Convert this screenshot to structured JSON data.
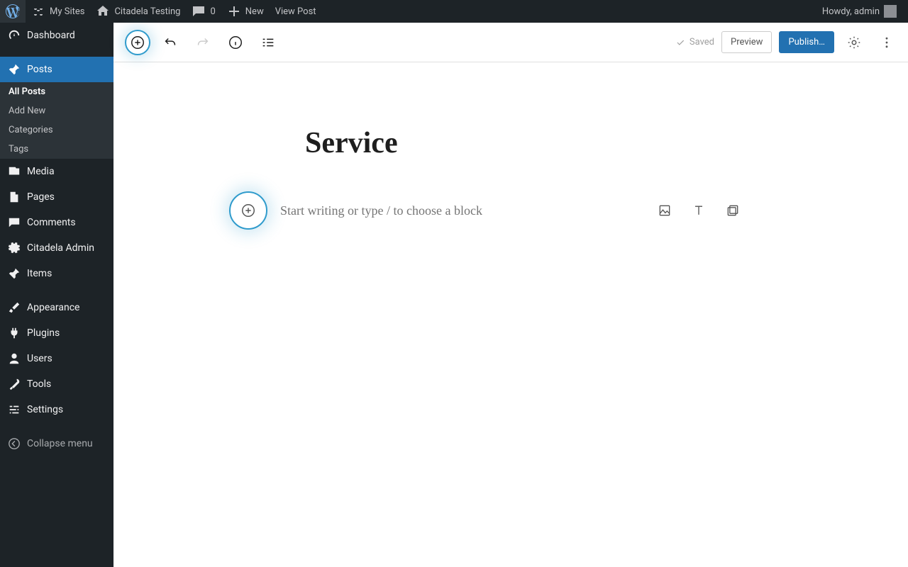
{
  "adminBar": {
    "mySites": "My Sites",
    "siteName": "Citadela Testing",
    "commentsCount": "0",
    "newLabel": "New",
    "viewPost": "View Post",
    "howdy": "Howdy, admin"
  },
  "sidebar": {
    "dashboard": "Dashboard",
    "posts": "Posts",
    "postsSub": {
      "allPosts": "All Posts",
      "addNew": "Add New",
      "categories": "Categories",
      "tags": "Tags"
    },
    "media": "Media",
    "pages": "Pages",
    "comments": "Comments",
    "citadelaAdmin": "Citadela Admin",
    "items": "Items",
    "appearance": "Appearance",
    "plugins": "Plugins",
    "users": "Users",
    "tools": "Tools",
    "settings": "Settings",
    "collapse": "Collapse menu"
  },
  "toolbar": {
    "saved": "Saved",
    "preview": "Preview",
    "publish": "Publish…"
  },
  "content": {
    "title": "Service",
    "placeholder": "Start writing or type / to choose a block"
  }
}
